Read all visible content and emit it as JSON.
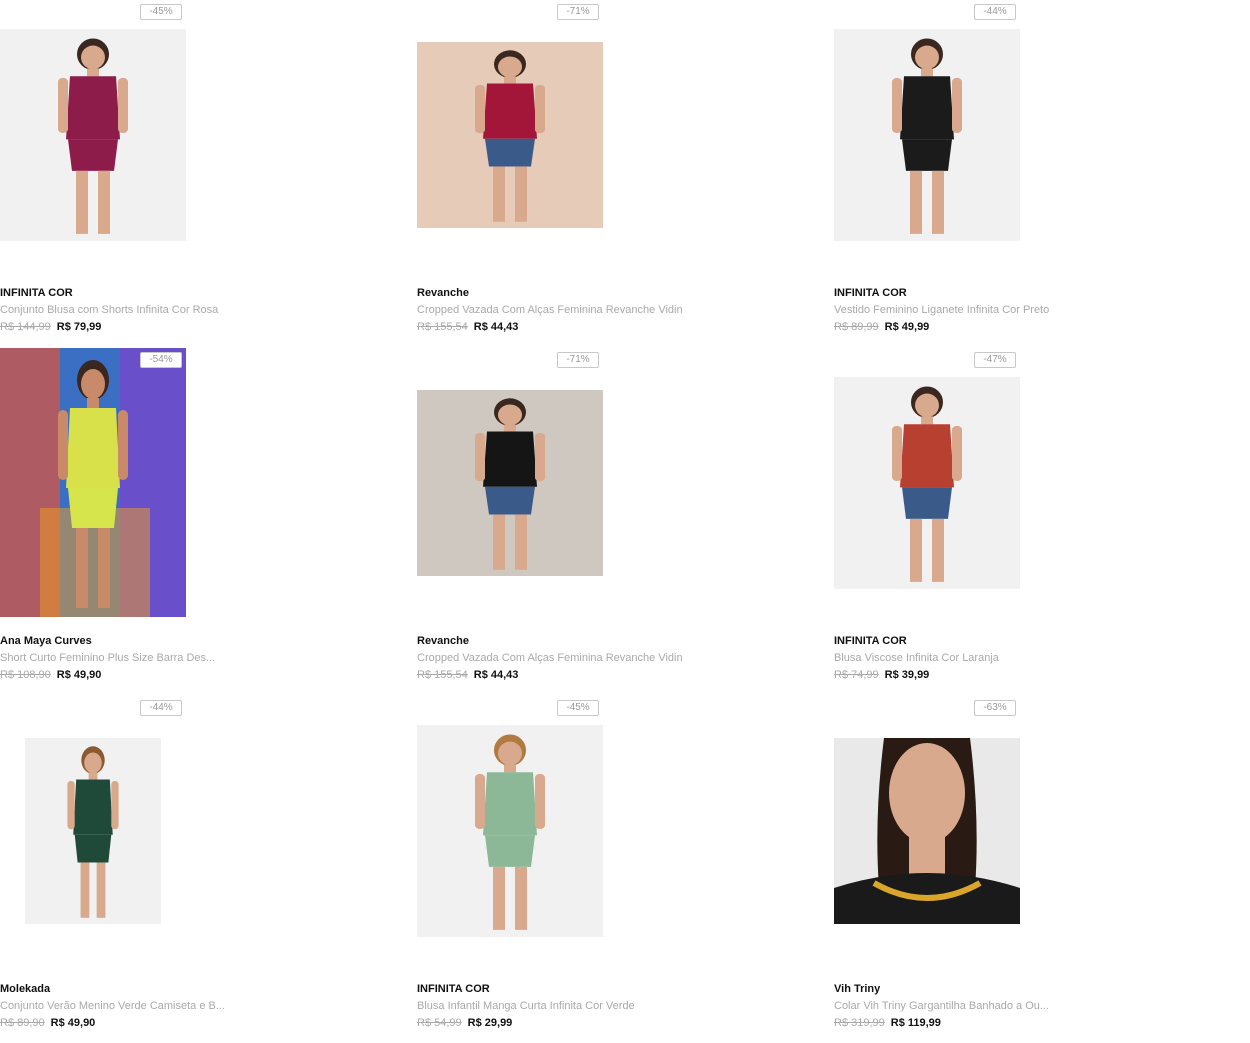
{
  "products": [
    {
      "discount": "-45%",
      "brand": "INFINITA COR",
      "name": "Conjunto Blusa com Shorts Infinita Cor Rosa",
      "old_price": "R$ 144,99",
      "new_price": "R$ 79,99",
      "image": "woman-magenta-romper-photo",
      "bg": "#f1f1f1",
      "accent": "#8e1c4a"
    },
    {
      "discount": "-71%",
      "brand": "Revanche",
      "name": "Cropped Vazada Com Alças Feminina Revanche Vidin",
      "old_price": "R$ 155,54",
      "new_price": "R$ 44,43",
      "image": "woman-red-cropped-top-photo",
      "bg": "#e7cbb9",
      "accent": "#a3163a"
    },
    {
      "discount": "-44%",
      "brand": "INFINITA COR",
      "name": "Vestido Feminino Liganete Infinita Cor Preto",
      "old_price": "R$ 89,99",
      "new_price": "R$ 49,99",
      "image": "woman-print-dress-photo",
      "bg": "#f1f1f1",
      "accent": "#1b1b1b"
    },
    {
      "discount": "-54%",
      "brand": "Ana Maya Curves",
      "name": "Short Curto Feminino Plus Size Barra Des...",
      "old_price": "R$ 108,90",
      "new_price": "R$ 49,90",
      "image": "woman-yellow-shorts-graffiti-photo",
      "bg": "#3b6fc4",
      "accent": "#d8e04a"
    },
    {
      "discount": "-71%",
      "brand": "Revanche",
      "name": "Cropped Vazada Com Alças Feminina Revanche Vidin",
      "old_price": "R$ 155,54",
      "new_price": "R$ 44,43",
      "image": "woman-black-cropped-top-photo",
      "bg": "#cfc8c0",
      "accent": "#151515"
    },
    {
      "discount": "-47%",
      "brand": "INFINITA COR",
      "name": "Blusa Viscose Infinita Cor Laranja",
      "old_price": "R$ 74,99",
      "new_price": "R$ 39,99",
      "image": "woman-orange-blouse-photo",
      "bg": "#f1f1f1",
      "accent": "#b84030"
    },
    {
      "discount": "-44%",
      "brand": "Molekada",
      "name": "Conjunto Verão Menino Verde Camiseta e B...",
      "old_price": "R$ 89,90",
      "new_price": "R$ 49,90",
      "image": "boy-green-tshirt-photo",
      "bg": "#f1f1f1",
      "accent": "#1f4a3a"
    },
    {
      "discount": "-45%",
      "brand": "INFINITA COR",
      "name": "Blusa Infantil Manga Curta Infinita Cor Verde",
      "old_price": "R$ 54,99",
      "new_price": "R$ 29,99",
      "image": "girl-green-blouse-photo",
      "bg": "#f1f1f1",
      "accent": "#8cb898"
    },
    {
      "discount": "-63%",
      "brand": "Vih Triny",
      "name": "Colar Vih Triny Gargantilha Banhado a Ou...",
      "old_price": "R$ 319,99",
      "new_price": "R$ 119,99",
      "image": "woman-gold-necklace-photo",
      "bg": "#e9e9e9",
      "accent": "#d9a52a"
    }
  ]
}
